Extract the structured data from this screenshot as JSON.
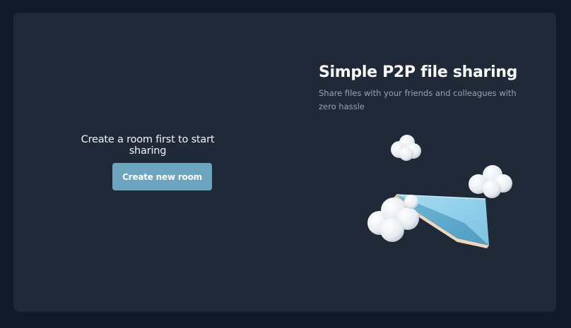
{
  "left": {
    "prompt": "Create a room first to start sharing",
    "create_button_label": "Create new room"
  },
  "hero": {
    "title": "Simple P2P file sharing",
    "subtitle": "Share files with your friends and colleagues with zero hassle",
    "illustration": "paper-plane-with-clouds"
  },
  "colors": {
    "background": "#121a29",
    "card": "#1f2937",
    "button": "#6ba5bf",
    "plane": "#8fd0ea"
  }
}
